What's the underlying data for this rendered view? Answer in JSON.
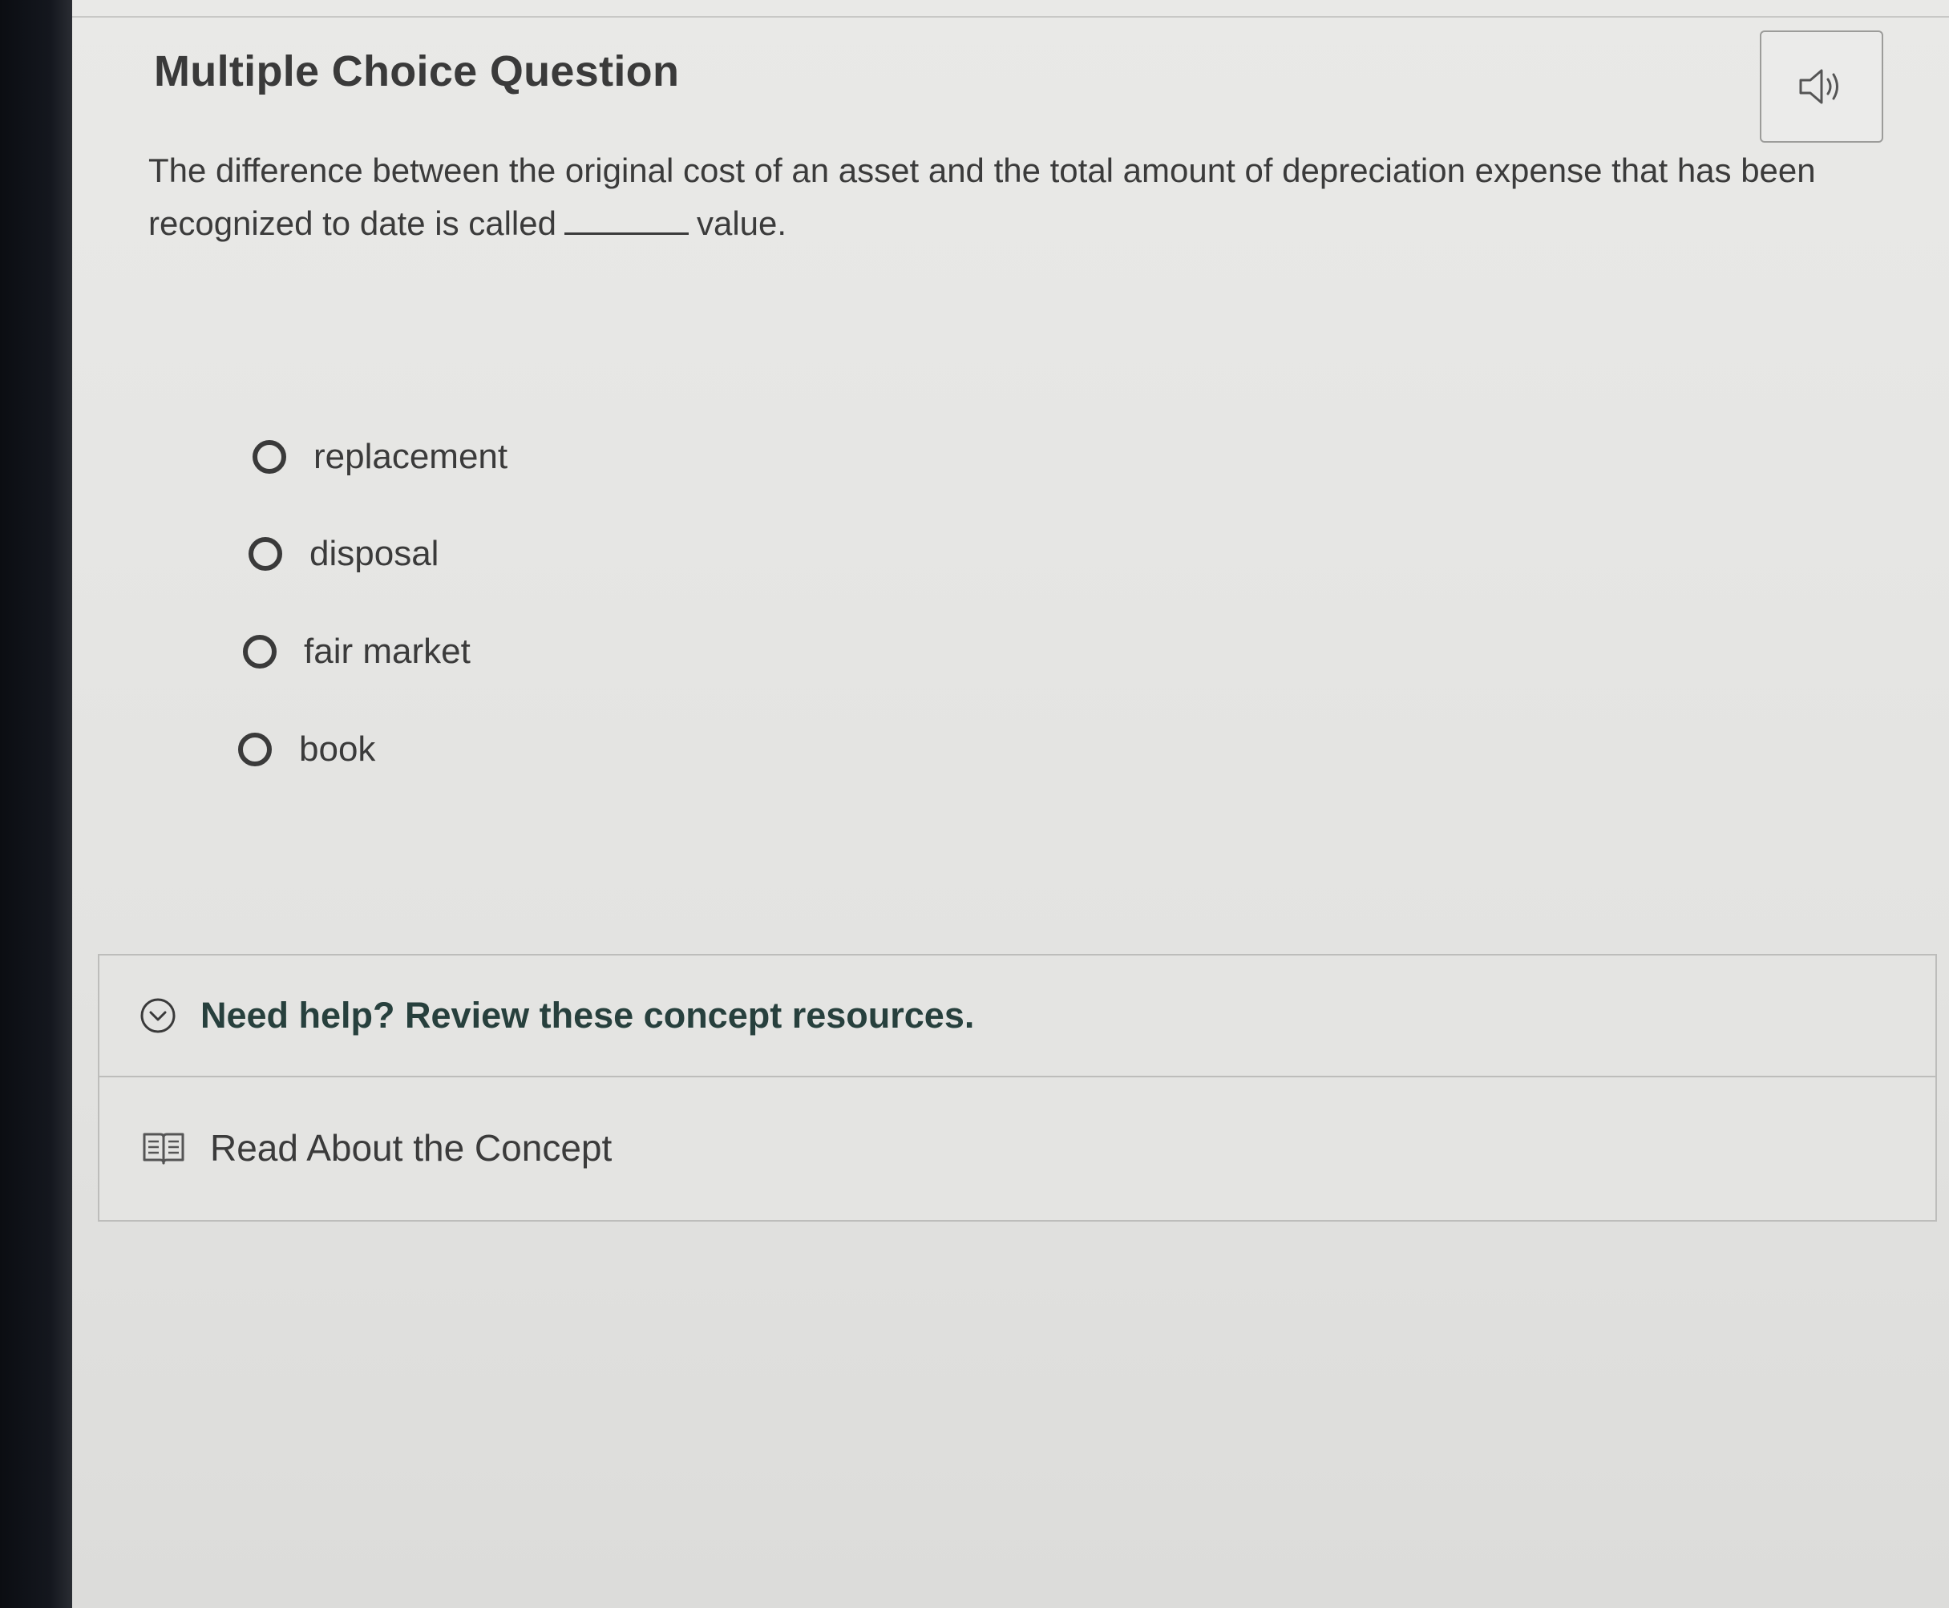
{
  "header": {
    "title": "Multiple Choice Question",
    "audio_icon": "speaker-icon"
  },
  "question": {
    "text_before": "The difference between the original cost of an asset and the total amount of depreciation expense that has been recognized to date is called",
    "text_after": "value."
  },
  "options": [
    {
      "label": "replacement",
      "selected": false
    },
    {
      "label": "disposal",
      "selected": false
    },
    {
      "label": "fair market",
      "selected": false
    },
    {
      "label": "book",
      "selected": false
    }
  ],
  "help": {
    "title": "Need help? Review these concept resources.",
    "toggle_icon": "chevron-down-circle-icon",
    "resources": [
      {
        "label": "Read About the Concept",
        "icon": "book-icon"
      }
    ]
  },
  "colors": {
    "help_title": "#27403d",
    "text": "#3b3b3b",
    "background": "#e6e6e4"
  }
}
